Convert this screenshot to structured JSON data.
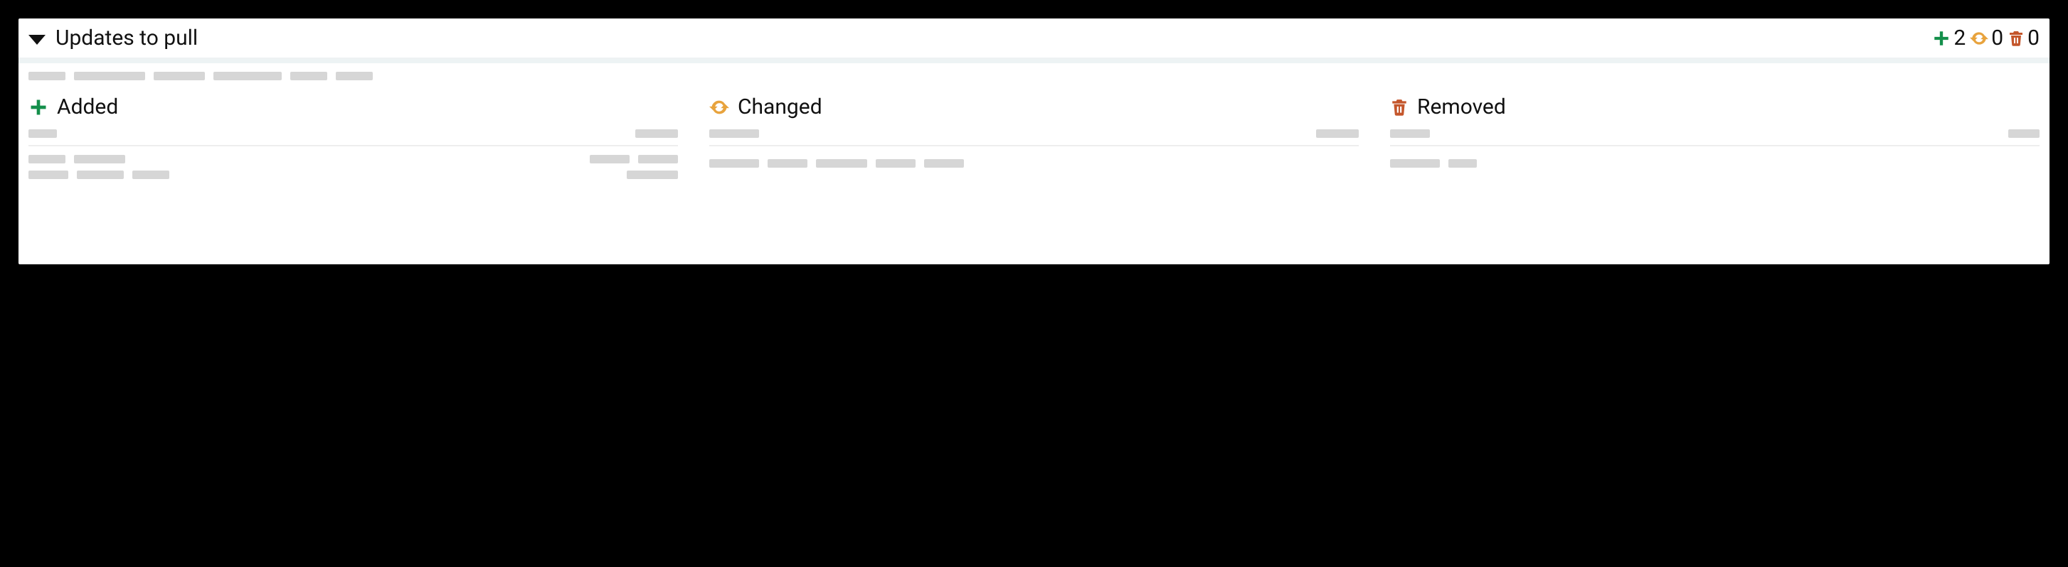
{
  "header": {
    "title": "Updates to pull",
    "counts": {
      "added": "2",
      "changed": "0",
      "removed": "0"
    }
  },
  "columns": {
    "added": {
      "label": "Added"
    },
    "changed": {
      "label": "Changed"
    },
    "removed": {
      "label": "Removed"
    }
  }
}
